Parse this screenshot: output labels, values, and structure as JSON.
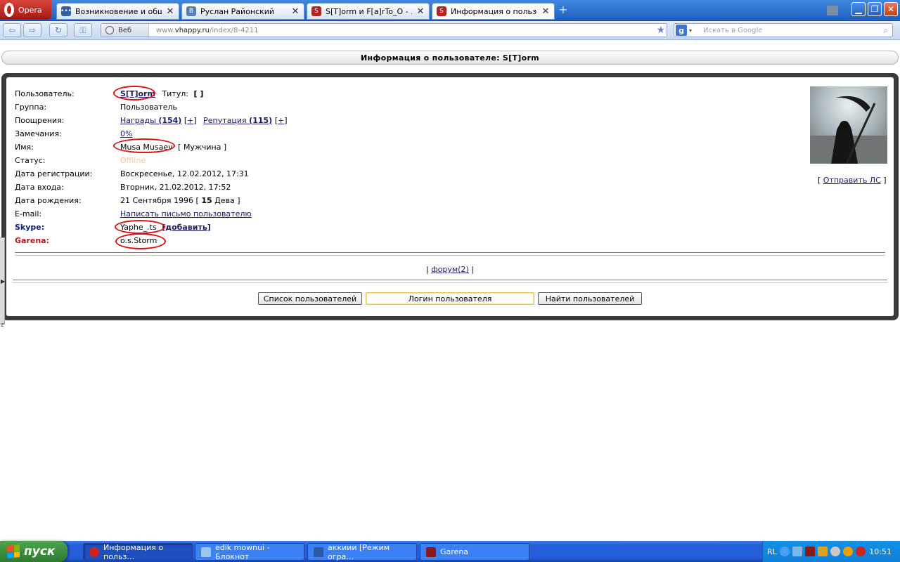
{
  "browser": {
    "menu_label": "Opera",
    "tabs": [
      {
        "title": "Возникновение и общ…",
        "color": "#2f5f9e"
      },
      {
        "title": "Руслан Районский",
        "color": "#5a7db0"
      },
      {
        "title": "S[T]orm и F[a]rTo_O - …",
        "color": "#b32222"
      },
      {
        "title": "Информация о пользо…",
        "color": "#b32222"
      }
    ],
    "new_tab_symbol": "+",
    "web_label": "Веб",
    "url_prefix": "www.",
    "url_host": "vhappy.ru",
    "url_path": "/index/8-4211",
    "search_placeholder": "Искать в Google",
    "search_engine_letter": "g"
  },
  "page": {
    "title": "Информация о пользователе: S[T]orm",
    "profile": {
      "user_label": "Пользователь:",
      "username": "S[T]orm",
      "title_label": "Титул:",
      "title_value": "[ ]",
      "group_label": "Группа:",
      "group_value": "Пользователь",
      "rewards_label": "Поощрения:",
      "awards_text": "Награды",
      "awards_count": "(154)",
      "awards_plus": "+",
      "rep_text": "Репутация",
      "rep_count": "(115)",
      "rep_plus": "+",
      "remarks_label": "Замечания:",
      "remarks_value": "0%",
      "name_label": "Имя:",
      "name_value": "Musa Musaev",
      "gender_value": "[ Мужчина ]",
      "status_label": "Статус:",
      "status_value": "Offline",
      "reg_label": "Дата регистрации:",
      "reg_value": "Воскресенье, 12.02.2012, 17:31",
      "login_label": "Дата входа:",
      "login_value": "Вторник, 21.02.2012, 17:52",
      "birth_label": "Дата рождения:",
      "birth_value": "21 Сентября 1996 [",
      "birth_age": "15",
      "birth_sign": "Дева ]",
      "email_label": "E-mail:",
      "email_value": "Написать письмо пользователю",
      "skype_label": "Skype:",
      "skype_value": "Yaphe_.ts",
      "skype_add": "[добавить]",
      "garena_label": "Garena:",
      "garena_value": "o.s.Storm"
    },
    "send_pm": "Отправить ЛС",
    "forum_link": "форум(2)",
    "buttons": {
      "users_list": "Список пользователей",
      "login_field": "Логин пользователя",
      "find_users": "Найти пользователей"
    }
  },
  "taskbar": {
    "start_label": "пуск",
    "tasks": [
      {
        "title": "Информация о польз…",
        "active": true,
        "color": "#d0241b"
      },
      {
        "title": "edik mownui - Блокнот",
        "active": false,
        "color": "#9cc7f0"
      },
      {
        "title": "аккиии [Режим огра…",
        "active": false,
        "color": "#2b5aa8"
      },
      {
        "title": "Garena",
        "active": false,
        "color": "#8a1a1a"
      }
    ],
    "lang": "RL",
    "time": "10:51"
  }
}
